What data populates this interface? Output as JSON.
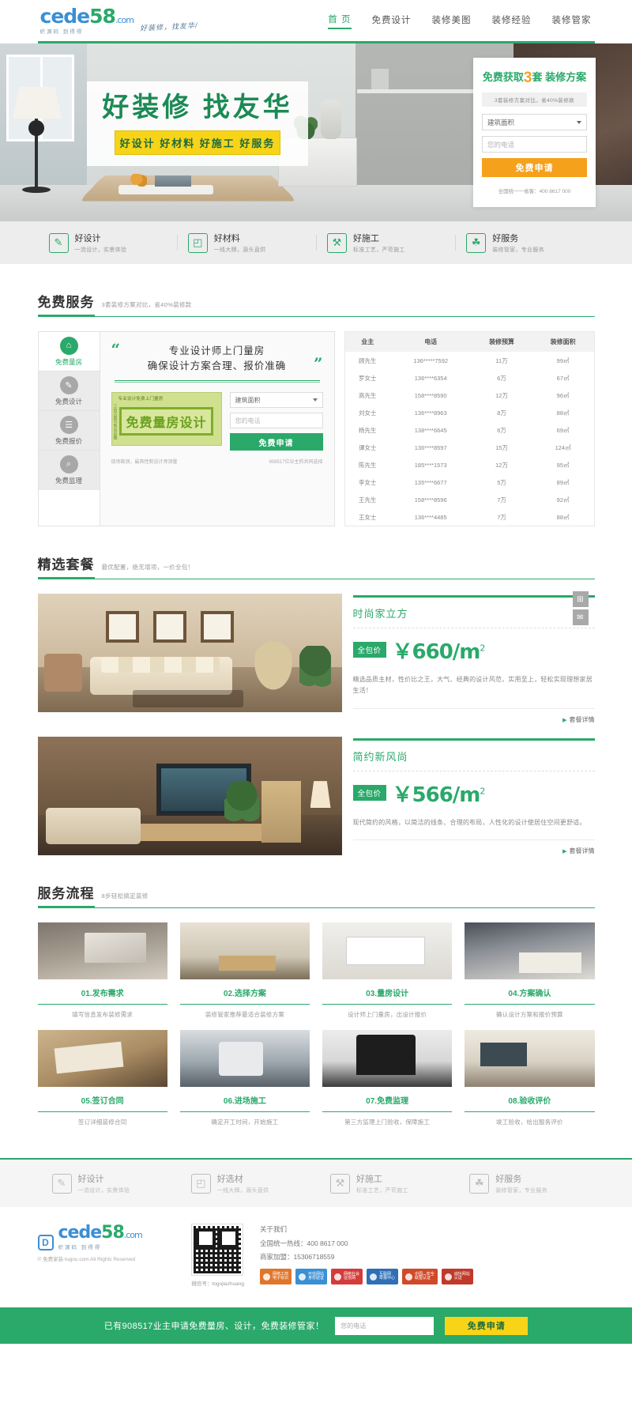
{
  "site": {
    "logo_text_1": "cede",
    "logo_text_2": "58",
    "logo_dotcom": ".com",
    "logo_sub": "织源码 到得得",
    "logo_slogan": "好装修，找友华/"
  },
  "nav": {
    "items": [
      {
        "label": "首 页",
        "active": true
      },
      {
        "label": "免费设计",
        "active": false
      },
      {
        "label": "装修美图",
        "active": false
      },
      {
        "label": "装修经验",
        "active": false
      },
      {
        "label": "装修管家",
        "active": false
      }
    ]
  },
  "banner": {
    "title": "好装修 找友华",
    "subtitle": "好设计  好材料  好施工  好服务",
    "form": {
      "title_pre": "免费获取",
      "title_num": "3",
      "title_post": "套 装修方案",
      "note": "3套装修方案对比，省40%装修款",
      "area_value": "建筑面积",
      "phone_placeholder": "您的电话",
      "submit": "免费申请",
      "hotline": "全国统一一省客：400 8617 000"
    }
  },
  "features": [
    {
      "icon": "pencil-icon",
      "glyph": "✎",
      "title": "好设计",
      "desc": "一流设计，实景体验"
    },
    {
      "icon": "layers-icon",
      "glyph": "◰",
      "title": "好材料",
      "desc": "一线大牌，源头直供"
    },
    {
      "icon": "tools-icon",
      "glyph": "⚒",
      "title": "好施工",
      "desc": "标准工艺，严苛施工"
    },
    {
      "icon": "service-icon",
      "glyph": "☘",
      "title": "好服务",
      "desc": "装修管家，专业服务"
    }
  ],
  "free_service": {
    "section_title": "免费服务",
    "section_sub": "3套装修方案对比，省40%装修款",
    "tabs": [
      {
        "label": "免费量房",
        "icon": "home-icon",
        "glyph": "⌂",
        "active": true
      },
      {
        "label": "免费设计",
        "icon": "pencil-icon",
        "glyph": "✎",
        "active": false
      },
      {
        "label": "免费报价",
        "icon": "clipboard-icon",
        "glyph": "☰",
        "active": false
      },
      {
        "label": "免费监理",
        "icon": "search-icon",
        "glyph": "⌕",
        "active": false
      }
    ],
    "quote_line1": "专业设计师上门量房",
    "quote_line2": "确保设计方案合理、报价准确",
    "promo": {
      "tag": "专业设计免费上门量房",
      "side": "三估万案可免出出图",
      "main": "免费量房设计"
    },
    "form": {
      "area_value": "建筑面积",
      "phone_placeholder": "您的电话",
      "submit": "免费申请"
    },
    "footnote_left": "现场勘测，最具性制设计师测量",
    "footnote_right": "908517位业主的共同选择",
    "table": {
      "headers": [
        "业主",
        "电话",
        "装修预算",
        "装修面积"
      ],
      "rows": [
        [
          "顾先生",
          "136*****7592",
          "11万",
          "99㎡"
        ],
        [
          "罗女士",
          "136****6354",
          "6万",
          "67㎡"
        ],
        [
          "高先生",
          "158****8590",
          "12万",
          "96㎡"
        ],
        [
          "刘女士",
          "136****8963",
          "8万",
          "88㎡"
        ],
        [
          "杨先生",
          "138****6645",
          "6万",
          "69㎡"
        ],
        [
          "谭女士",
          "136****8597",
          "15万",
          "124㎡"
        ],
        [
          "陈先生",
          "185****1573",
          "12万",
          "95㎡"
        ],
        [
          "李女士",
          "135****6677",
          "5万",
          "89㎡"
        ],
        [
          "王先生",
          "158****8596",
          "7万",
          "92㎡"
        ],
        [
          "王女士",
          "136****4485",
          "7万",
          "88㎡"
        ]
      ]
    }
  },
  "packages": {
    "section_title": "精选套餐",
    "section_sub": "最优配置，绝无增项，一价全包！",
    "items": [
      {
        "name": "时尚家立方",
        "tag": "全包价",
        "currency": "￥",
        "price": "660/m",
        "unit_sup": "2",
        "desc": "精选品质主材，性价比之王，大气、经典的设计风范，实用至上，轻松实现理想家居生活！",
        "more": "套餐详情",
        "image": "living-room-photo"
      },
      {
        "name": "简约新风尚",
        "tag": "全包价",
        "currency": "￥",
        "price": "566/m",
        "unit_sup": "2",
        "desc": "现代简约的风格，以简洁的线条、合理的布局，人性化的设计使居住空间更舒适。",
        "more": "套餐详情",
        "image": "tv-wall-photo"
      }
    ]
  },
  "process": {
    "section_title": "服务流程",
    "section_sub": "8步轻松搞定装修",
    "steps": [
      {
        "title": "01.发布需求",
        "desc": "填写信息发布装修需求",
        "image": "laptop-photo"
      },
      {
        "title": "02.选择方案",
        "desc": "装修管家推荐最适合装修方案",
        "image": "dining-room-photo"
      },
      {
        "title": "03.量房设计",
        "desc": "设计师上门量房，出设计报价",
        "image": "blueprint-photo"
      },
      {
        "title": "04.方案确认",
        "desc": "确认设计方案和报价预算",
        "image": "meeting-photo"
      },
      {
        "title": "05.签订合同",
        "desc": "签订详细装修合同",
        "image": "contract-photo"
      },
      {
        "title": "06.进场施工",
        "desc": "确定开工时间，开始施工",
        "image": "painting-photo"
      },
      {
        "title": "07.免费监理",
        "desc": "第三方监理上门验收，保障施工",
        "image": "supervisor-photo"
      },
      {
        "title": "08.验收评价",
        "desc": "竣工验收，给出服务评价",
        "image": "finished-room-photo"
      }
    ]
  },
  "footer_strip": [
    {
      "icon": "pencil-icon",
      "glyph": "✎",
      "title": "好设计",
      "desc": "一流设计，实景体验"
    },
    {
      "icon": "layers-icon",
      "glyph": "◰",
      "title": "好选材",
      "desc": "一线大牌，源头直供"
    },
    {
      "icon": "tools-icon",
      "glyph": "⚒",
      "title": "好施工",
      "desc": "标准工艺，严苛施工"
    },
    {
      "icon": "service-icon",
      "glyph": "☘",
      "title": "好服务",
      "desc": "装修管家，专业服务"
    }
  ],
  "footer": {
    "logo_badge": "D",
    "logo_text_1": "cede",
    "logo_text_2": "58",
    "logo_dotcom": ".com",
    "logo_sub": "织源码 到得得",
    "copyright": "© 免费家装-tugou.com All Rights Reserved",
    "qr_label": "微信号：togojiazhuang",
    "about_title": "关于我们",
    "hotline": "全国统一热线：400 8617 000",
    "franchise": "商家加盟：15306718559",
    "certs": [
      {
        "line1": "网络工商",
        "line2": "电子标识"
      },
      {
        "line1": "可信网站",
        "line2": "身份验证"
      },
      {
        "line1": "网络社会",
        "line2": "征信网"
      },
      {
        "line1": "互联网",
        "line2": "举报中心"
      },
      {
        "line1": "中国ب安全",
        "line2": "联盟认证"
      },
      {
        "line1": "诚信网站",
        "line2": "认证"
      }
    ]
  },
  "bottom_bar": {
    "text": "已有908517业主申请免费量房、设计，免费装修管家！",
    "input_placeholder": "您的电话",
    "button": "免费申请"
  },
  "dock": [
    {
      "icon": "qrcode-icon",
      "glyph": "⊞"
    },
    {
      "icon": "message-icon",
      "glyph": "✉"
    }
  ],
  "colors": {
    "brand_green": "#2aa96a",
    "accent_orange": "#f5a11b",
    "accent_yellow": "#f7d417",
    "logo_blue": "#3b8fd4"
  }
}
